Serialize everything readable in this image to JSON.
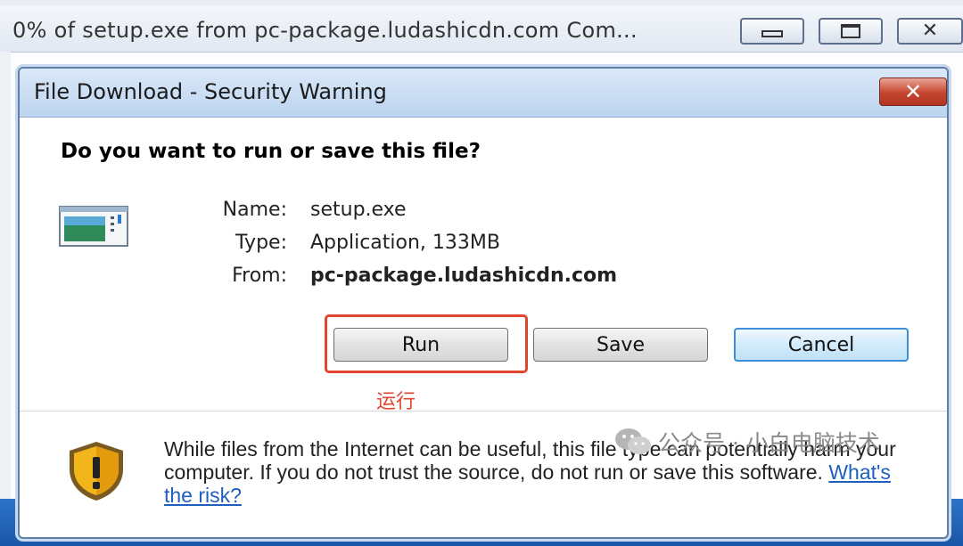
{
  "background_window": {
    "title": "0% of setup.exe from pc-package.ludashicdn.com Com..."
  },
  "dialog": {
    "title": "File Download - Security Warning",
    "question": "Do you want to run or save this file?",
    "file_info": {
      "name_label": "Name:",
      "name_value": "setup.exe",
      "type_label": "Type:",
      "type_value": "Application, 133MB",
      "from_label": "From:",
      "from_value": "pc-package.ludashicdn.com"
    },
    "buttons": {
      "run": "Run",
      "save": "Save",
      "cancel": "Cancel"
    },
    "annotation": "运行",
    "warning": {
      "text": "While files from the Internet can be useful, this file type can potentially harm your computer. If you do not trust the source, do not run or save this software.",
      "link": "What's the risk?"
    }
  },
  "watermark": "公众号 · 小白电脑技术",
  "colors": {
    "highlight": "#e0452d",
    "link": "#1f5fbf",
    "close_button": "#c4442e"
  },
  "icons": [
    "minimize-icon",
    "maximize-icon",
    "close-icon",
    "application-file-icon",
    "security-shield-icon",
    "wechat-icon"
  ]
}
